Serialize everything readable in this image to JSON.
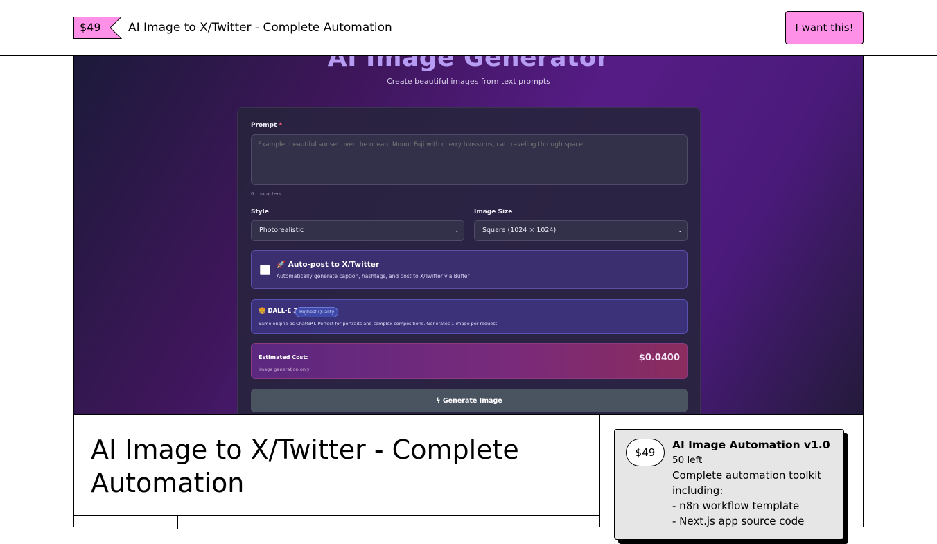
{
  "header": {
    "price": "$49",
    "title": "AI Image to X/Twitter - Complete Automation",
    "cta_label": "I want this!"
  },
  "cover": {
    "app_title": "AI Image Generator",
    "app_subtitle": "Create beautiful images from text prompts",
    "prompt_label": "Prompt",
    "prompt_required_mark": "*",
    "prompt_placeholder": "Example: beautiful sunset over the ocean, Mount Fuji with cherry blossoms, cat traveling through space...",
    "char_count": "0 characters",
    "style_label": "Style",
    "style_value": "Photorealistic",
    "size_label": "Image Size",
    "size_value": "Square (1024 × 1024)",
    "autopost_title": "🚀 Auto-post to X/Twitter",
    "autopost_desc": "Automatically generate caption, hashtags, and post to X/Twitter via Buffer",
    "autopost_checked": false,
    "model_title": "🍔 DALL-E 3",
    "model_badge": "Highest Quality",
    "model_desc": "Same engine as ChatGPT. Perfect for portraits and complex compositions. Generates 1 image per request.",
    "cost_label": "Estimated Cost:",
    "cost_sub": "Image generation only",
    "cost_value": "$0.0400",
    "generate_label": "Generate Image"
  },
  "product": {
    "title": "AI Image to X/Twitter - Complete Automation"
  },
  "offer": {
    "price": "$49",
    "name": "AI Image Automation v1.0",
    "remaining": "50 left",
    "description_lines": [
      "Complete automation toolkit including:",
      "- n8n workflow template",
      "- Next.js app source code"
    ]
  },
  "colors": {
    "accent_pink": "#ff90e8",
    "cover_purple": "#561c86"
  }
}
